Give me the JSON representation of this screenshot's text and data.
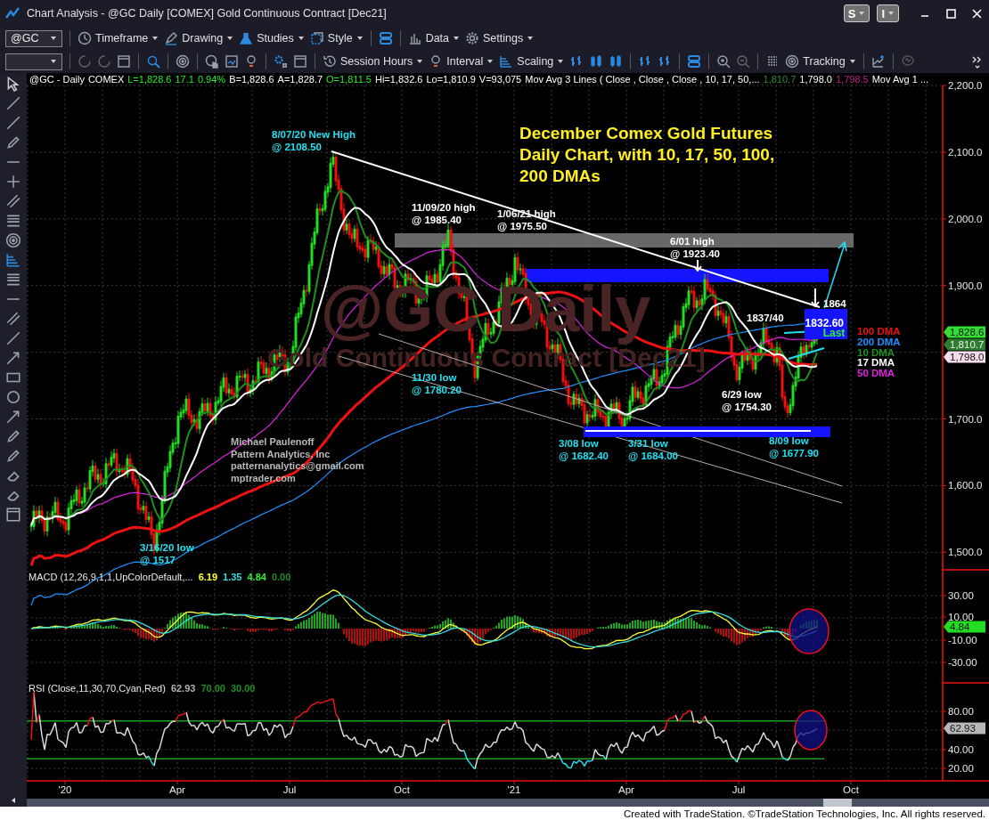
{
  "window": {
    "title": "Chart Analysis - @GC Daily [COMEX] Gold Continuous Contract [Dec21]",
    "buttons": [
      "S",
      "I"
    ]
  },
  "toolbar_1": {
    "symbol": "@GC",
    "items": [
      "Timeframe",
      "Drawing",
      "Studies",
      "Style",
      "Data",
      "Settings"
    ]
  },
  "toolbar_2": {
    "items": [
      "Session Hours",
      "Interval",
      "Scaling",
      "Tracking"
    ]
  },
  "status_line": [
    {
      "text": "@GC - Daily",
      "color": "#ffffff"
    },
    {
      "text": "COMEX",
      "color": "#ffffff"
    },
    {
      "text": "L=1,828.6",
      "color": "#22ee22"
    },
    {
      "text": "17.1",
      "color": "#22ee22"
    },
    {
      "text": "0.94%",
      "color": "#22ee22"
    },
    {
      "text": "B=1,828.6",
      "color": "#ffffff"
    },
    {
      "text": "A=1,828.7",
      "color": "#ffffff"
    },
    {
      "text": "O=1,811.5",
      "color": "#22ee22"
    },
    {
      "text": "Hi=1,832.6",
      "color": "#ffffff"
    },
    {
      "text": "Lo=1,810.9",
      "color": "#ffffff"
    },
    {
      "text": "V=93,075",
      "color": "#ffffff"
    },
    {
      "text": "Mov Avg 3 Lines (  Close ,  Close ,  Close , 10, 17, 50,...",
      "color": "#ffffff"
    },
    {
      "text": "1,810.7",
      "color": "#2e8b2e"
    },
    {
      "text": "1,798.0",
      "color": "#ffffff"
    },
    {
      "text": "1,798.5",
      "color": "#c0208a"
    },
    {
      "text": "Mov Avg 1 ...",
      "color": "#ffffff"
    }
  ],
  "price_panel": {
    "symbol_watermark": [
      "@GC Daily",
      "Gold Continuous Contract [Dec21]"
    ],
    "title": [
      "December Comex Gold Futures",
      "Daily Chart, with 10, 17, 50, 100,",
      "200 DMAs"
    ],
    "author": [
      "Michael Paulenoff",
      "Pattern Analytics, Inc",
      "patternanalytics@gmail.com",
      "mptrader.com"
    ],
    "annotations": [
      {
        "lines": [
          "8/07/20 New High",
          "@ 2108.50"
        ],
        "color": "#22e0f0"
      },
      {
        "lines": [
          "11/09/20 high",
          "@ 1985.40"
        ],
        "color": "#ffffff"
      },
      {
        "lines": [
          "1/06/21 high",
          "@ 1975.50"
        ],
        "color": "#ffffff"
      },
      {
        "lines": [
          "6/01 high",
          "@ 1923.40"
        ],
        "color": "#ffffff"
      },
      {
        "lines": [
          "1864"
        ],
        "color": "#ffffff"
      },
      {
        "lines": [
          "1837/40"
        ],
        "color": "#ffffff"
      },
      {
        "lines": [
          "11/30 low",
          "@ 1780.20"
        ],
        "color": "#22e0f0"
      },
      {
        "lines": [
          "6/29 low",
          "@ 1754.30"
        ],
        "color": "#ffffff"
      },
      {
        "lines": [
          "3/08 low",
          "@ 1682.40"
        ],
        "color": "#22e0f0"
      },
      {
        "lines": [
          "3/31 low",
          "@ 1684.00"
        ],
        "color": "#22e0f0"
      },
      {
        "lines": [
          "8/09 low",
          "@ 1677.90"
        ],
        "color": "#22e0f0"
      },
      {
        "lines": [
          "3/16/20 low",
          "@ 1517"
        ],
        "color": "#22e0f0"
      }
    ],
    "last_box": {
      "price": "1832.60",
      "label": "Last"
    },
    "ma_labels": [
      {
        "text": "100 DMA",
        "color": "#ee1111"
      },
      {
        "text": "200 DMA",
        "color": "#1e90ff"
      },
      {
        "text": "10 DMA",
        "color": "#1f8f1f"
      },
      {
        "text": "17 DMA",
        "color": "#ffffff"
      },
      {
        "text": "50 DMA",
        "color": "#e020e0"
      }
    ],
    "y_ticks": [
      "2,200.0",
      "2,100.0",
      "2,000.0",
      "1,900.0",
      "1,700.0",
      "1,600.0",
      "1,500.0"
    ],
    "price_tags": [
      {
        "text": "1,828.6",
        "color": "#33dd33"
      },
      {
        "text": "1,810.7",
        "color": "#2e7d2e"
      },
      {
        "text": "1,798.0",
        "color": "#f4dcea"
      }
    ]
  },
  "macd_panel": {
    "label": "MACD (12,26,9,1,1,UpColorDefault,...",
    "values": [
      {
        "text": "6.19",
        "color": "#ffff33"
      },
      {
        "text": "1.35",
        "color": "#33dddd"
      },
      {
        "text": "4.84",
        "color": "#33ee33"
      },
      {
        "text": "0.00",
        "color": "#1f8f1f"
      }
    ],
    "y_ticks": [
      "30.00",
      "10.00",
      "-10.00",
      "-30.00"
    ],
    "tag": "4.84"
  },
  "rsi_panel": {
    "label": "RSI (Close,11,30,70,Cyan,Red)",
    "values": [
      {
        "text": "62.93",
        "color": "#b0b0b0"
      },
      {
        "text": "70.00",
        "color": "#1f8f1f"
      },
      {
        "text": "30.00",
        "color": "#1f8f1f"
      }
    ],
    "y_ticks": [
      "80.00",
      "40.00",
      "20.00"
    ],
    "tag": "62.93"
  },
  "x_axis": [
    "'20",
    "Apr",
    "Jul",
    "Oct",
    "'21",
    "Apr",
    "Jul",
    "Oct"
  ],
  "footer": "Created with TradeStation. ©TradeStation Technologies, Inc. All rights reserved."
}
